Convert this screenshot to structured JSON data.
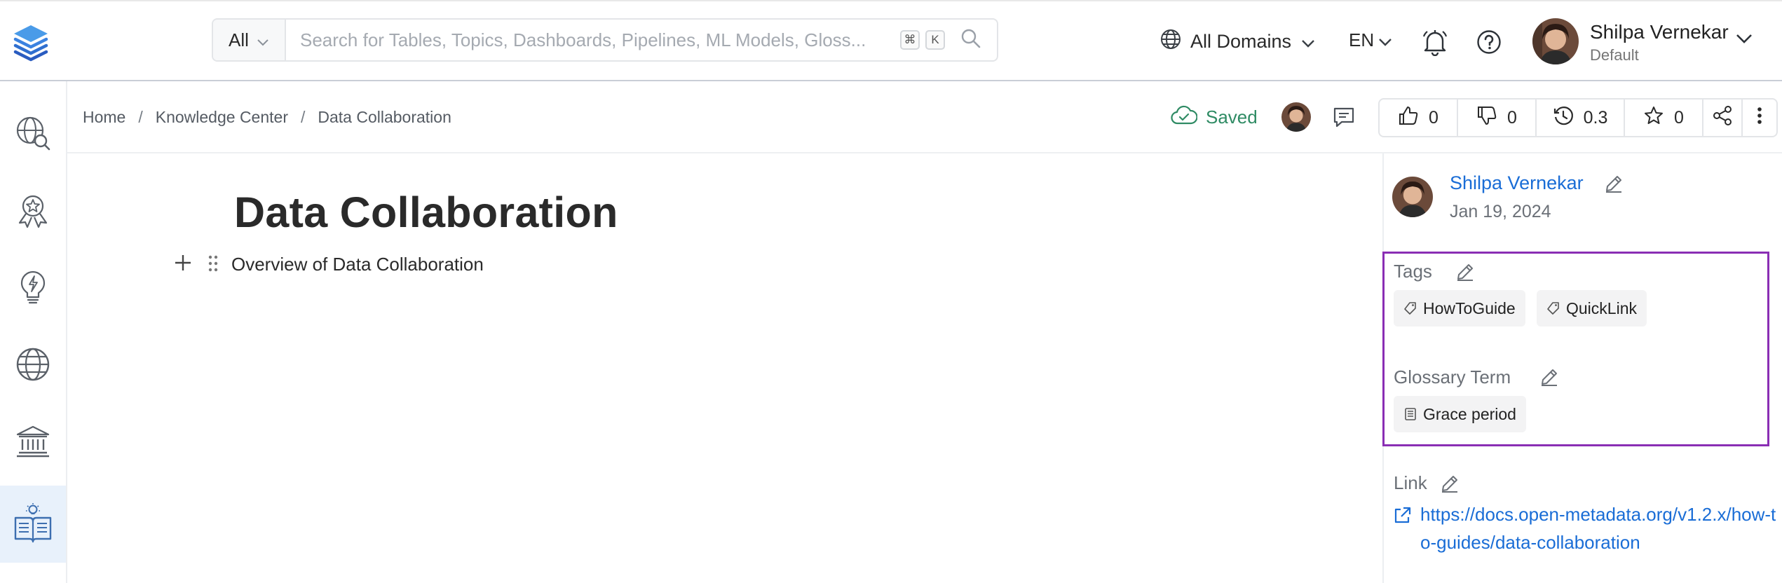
{
  "header": {
    "search_scope": "All",
    "search_placeholder": "Search for Tables, Topics, Dashboards, Pipelines, ML Models, Gloss...",
    "shortcut_keys": [
      "⌘",
      "K"
    ],
    "domains_label": "All Domains",
    "language": "EN",
    "user": {
      "name": "Shilpa Vernekar",
      "role": "Default"
    }
  },
  "sidebar": {
    "items": [
      {
        "icon": "explore-globe-search-icon",
        "active": false
      },
      {
        "icon": "quality-badge-icon",
        "active": false
      },
      {
        "icon": "insights-bulb-icon",
        "active": false
      },
      {
        "icon": "domains-globe-icon",
        "active": false
      },
      {
        "icon": "governance-bank-icon",
        "active": false
      },
      {
        "icon": "knowledge-book-icon",
        "active": true
      }
    ]
  },
  "breadcrumb": [
    "Home",
    "Knowledge Center",
    "Data Collaboration"
  ],
  "status": {
    "saved_label": "Saved"
  },
  "actions": {
    "upvotes": "0",
    "downvotes": "0",
    "version": "0.3",
    "follows": "0"
  },
  "document": {
    "title": "Data Collaboration",
    "paragraph": "Overview of Data Collaboration"
  },
  "right_panel": {
    "owner_name": "Shilpa Vernekar",
    "updated_date": "Jan 19, 2024",
    "tags_label": "Tags",
    "tags": [
      "HowToGuide",
      "QuickLink"
    ],
    "glossary_label": "Glossary Term",
    "glossary_terms": [
      "Grace period"
    ],
    "link_label": "Link",
    "link_url": "https://docs.open-metadata.org/v1.2.x/how-to-guides/data-collaboration"
  },
  "colors": {
    "accent_link": "#1a6dd6",
    "saved_green": "#2f8b64",
    "highlight_purple": "#8a2eb4",
    "active_sidebar_bg": "#e8f1fb"
  }
}
